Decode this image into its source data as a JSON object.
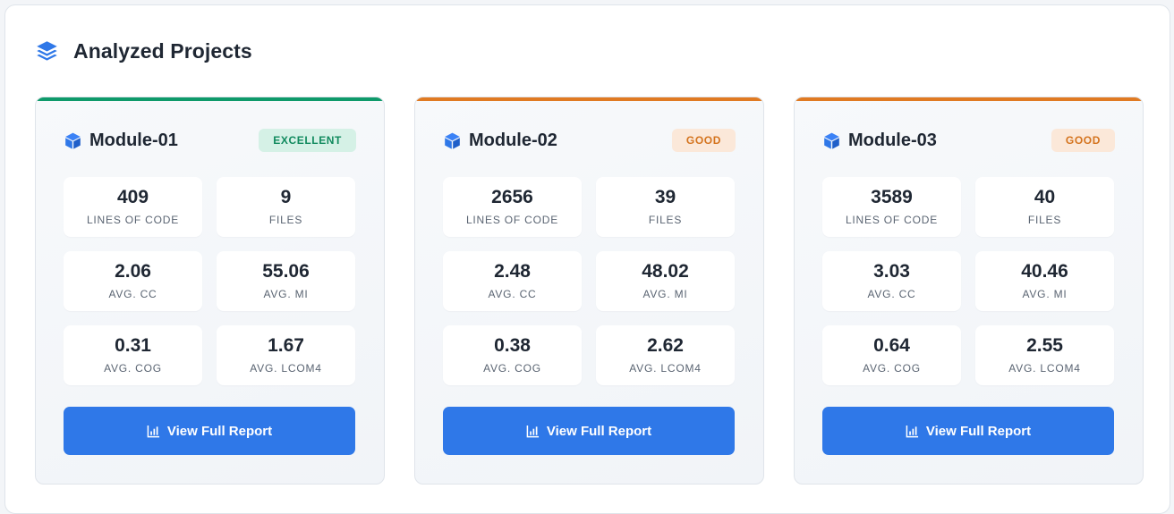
{
  "header": {
    "title": "Analyzed Projects",
    "icon": "layers-icon",
    "icon_color": "#2f78e8"
  },
  "cards": [
    {
      "name": "Module-01",
      "badge": "EXCELLENT",
      "accent_color": "#0e9a6a",
      "badge_bg": "#d5f1e6",
      "badge_color": "#118a5e",
      "metrics": {
        "loc": {
          "value": "409",
          "label": "Lines of Code"
        },
        "files": {
          "value": "9",
          "label": "Files"
        },
        "cc": {
          "value": "2.06",
          "label": "Avg. CC"
        },
        "mi": {
          "value": "55.06",
          "label": "Avg. MI"
        },
        "cog": {
          "value": "0.31",
          "label": "Avg. COG"
        },
        "lcom4": {
          "value": "1.67",
          "label": "Avg. LCOM4"
        }
      },
      "button_label": "View Full Report"
    },
    {
      "name": "Module-02",
      "badge": "GOOD",
      "accent_color": "#e07a22",
      "badge_bg": "#fbe8d9",
      "badge_color": "#d4731d",
      "metrics": {
        "loc": {
          "value": "2656",
          "label": "Lines of Code"
        },
        "files": {
          "value": "39",
          "label": "Files"
        },
        "cc": {
          "value": "2.48",
          "label": "Avg. CC"
        },
        "mi": {
          "value": "48.02",
          "label": "Avg. MI"
        },
        "cog": {
          "value": "0.38",
          "label": "Avg. COG"
        },
        "lcom4": {
          "value": "2.62",
          "label": "Avg. LCOM4"
        }
      },
      "button_label": "View Full Report"
    },
    {
      "name": "Module-03",
      "badge": "GOOD",
      "accent_color": "#e07a22",
      "badge_bg": "#fbe8d9",
      "badge_color": "#d4731d",
      "metrics": {
        "loc": {
          "value": "3589",
          "label": "Lines of Code"
        },
        "files": {
          "value": "40",
          "label": "Files"
        },
        "cc": {
          "value": "3.03",
          "label": "Avg. CC"
        },
        "mi": {
          "value": "40.46",
          "label": "Avg. MI"
        },
        "cog": {
          "value": "0.64",
          "label": "Avg. COG"
        },
        "lcom4": {
          "value": "2.55",
          "label": "Avg. LCOM4"
        }
      },
      "button_label": "View Full Report"
    }
  ],
  "icons": {
    "card": "cube-icon",
    "button": "chart-icon"
  }
}
